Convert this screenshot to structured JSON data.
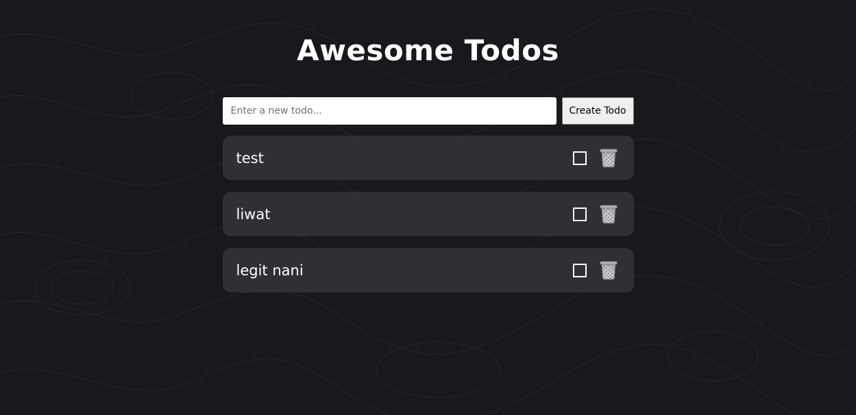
{
  "app": {
    "title": "Awesome Todos"
  },
  "form": {
    "placeholder": "Enter a new todo...",
    "value": "",
    "create_label": "Create Todo"
  },
  "todos": [
    {
      "text": "test",
      "done": false
    },
    {
      "text": "liwat",
      "done": false
    },
    {
      "text": "legit nani",
      "done": false
    }
  ],
  "icons": {
    "delete": "trash-icon",
    "complete": "checkbox"
  },
  "colors": {
    "background": "#1a171d",
    "card": "#343137",
    "title": "#ffffff"
  }
}
